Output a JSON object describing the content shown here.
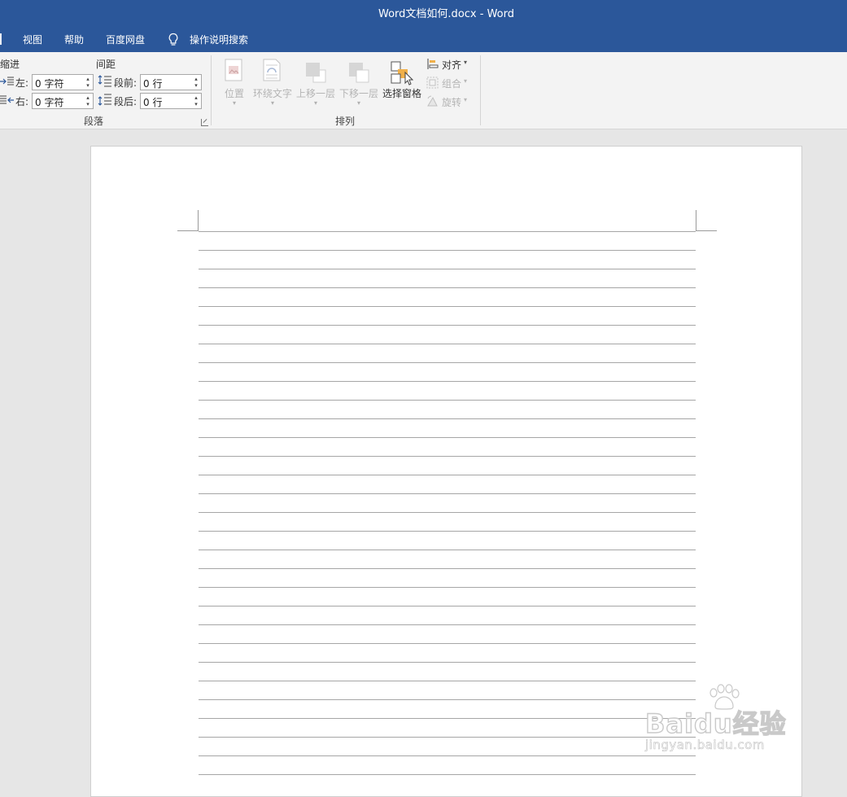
{
  "window": {
    "title": "Word文档如何.docx  -  Word"
  },
  "tabs": [
    "视图",
    "帮助",
    "百度网盘"
  ],
  "tell_me": {
    "label": "操作说明搜索",
    "icon": "lightbulb-icon"
  },
  "paragraph_group": {
    "label": "段落",
    "indent": {
      "heading": "缩进",
      "left_label": "左:",
      "left_value": "0 字符",
      "right_label": "右:",
      "right_value": "0 字符"
    },
    "spacing": {
      "heading": "间距",
      "before_label": "段前:",
      "before_value": "0 行",
      "after_label": "段后:",
      "after_value": "0 行"
    }
  },
  "arrange_group": {
    "label": "排列",
    "position": "位置",
    "wrap_text": "环绕文字",
    "bring_forward": "上移一层",
    "send_backward": "下移一层",
    "selection_pane": "选择窗格",
    "align": "对齐",
    "group": "组合",
    "rotate": "旋转"
  },
  "colors": {
    "accent": "#2b579a",
    "ribbon": "#f3f3f3",
    "canvas": "#e6e6e6",
    "selection_icon": "#f0b04a"
  },
  "watermark": {
    "logo": "Baidu经验",
    "url": "jingyan.baidu.com"
  }
}
